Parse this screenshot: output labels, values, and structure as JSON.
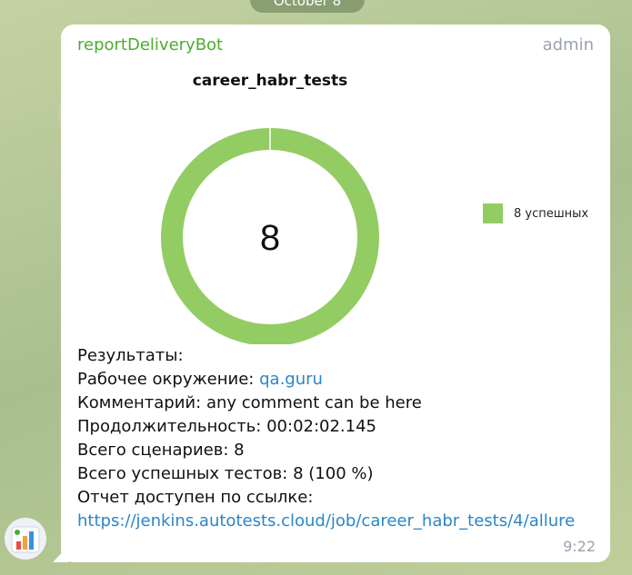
{
  "date_pill": "October 8",
  "message": {
    "sender": "reportDeliveryBot",
    "role": "admin",
    "time": "9:22"
  },
  "chart_data": {
    "type": "pie",
    "variant": "donut",
    "title": "career_habr_tests",
    "center_label": "8",
    "slices": [
      {
        "label": "8 успешных",
        "value": 8,
        "color": "#93cc63"
      }
    ],
    "legend": "right"
  },
  "results": {
    "heading": "Результаты:",
    "env_label": "Рабочее окружение:",
    "env_value": "qa.guru",
    "comment_label": "Комментарий:",
    "comment_value": "any comment can be here",
    "duration_label": "Продолжительность:",
    "duration_value": "00:02:02.145",
    "scenarios_label": "Всего сценариев:",
    "scenarios_value": "8",
    "passed_label": "Всего успешных тестов:",
    "passed_value": "8 (100 %)",
    "report_label": "Отчет доступен по ссылке:",
    "report_url": "https://jenkins.autotests.cloud/job/career_habr_tests/4/allure"
  }
}
